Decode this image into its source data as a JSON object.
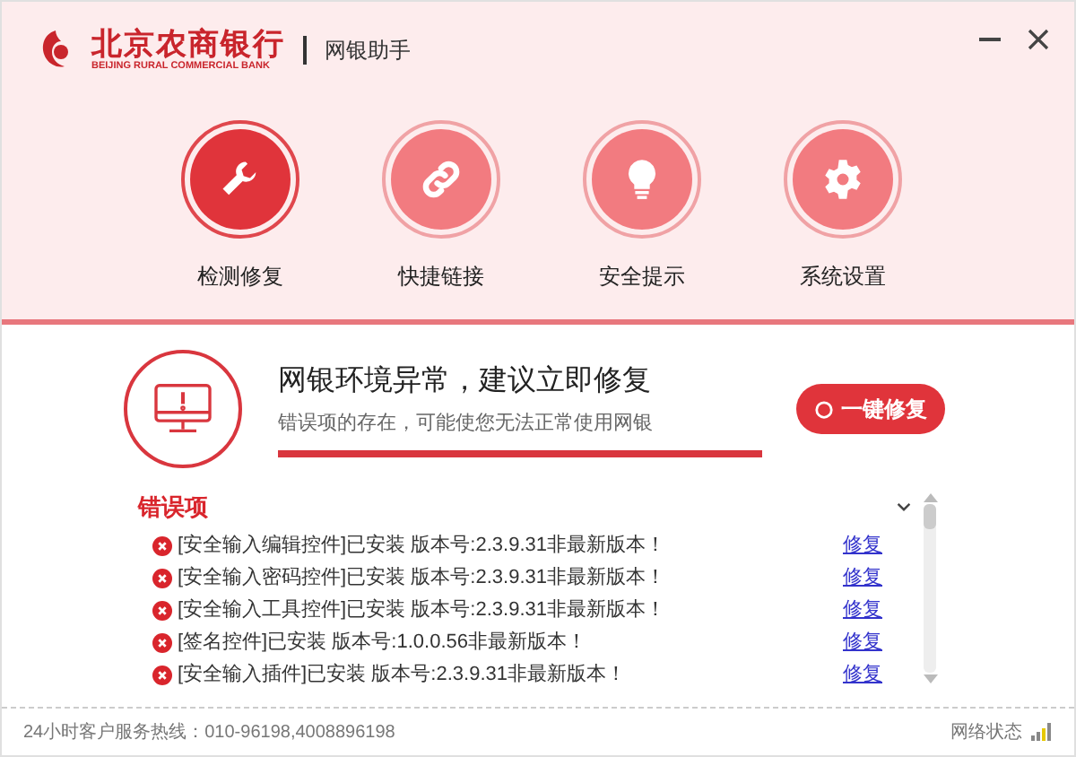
{
  "header": {
    "logo_name": "北京农商银行",
    "logo_subtitle": "BEIJING RURAL COMMERCIAL BANK",
    "app_name": "网银助手"
  },
  "nav": [
    {
      "label": "检测修复",
      "kind": "wrench",
      "selected": true
    },
    {
      "label": "快捷链接",
      "kind": "link",
      "selected": false
    },
    {
      "label": "安全提示",
      "kind": "bulb",
      "selected": false
    },
    {
      "label": "系统设置",
      "kind": "gear",
      "selected": false
    }
  ],
  "status": {
    "title": "网银环境异常，建议立即修复",
    "subtitle": "错误项的存在，可能使您无法正常使用网银",
    "level": 1,
    "fix_all_button": "一键修复"
  },
  "errors": {
    "heading": "错误项",
    "items": [
      {
        "text": "[安全输入编辑控件]已安装 版本号:2.3.9.31非最新版本！",
        "action": "修复"
      },
      {
        "text": "[安全输入密码控件]已安装 版本号:2.3.9.31非最新版本！",
        "action": "修复"
      },
      {
        "text": "[安全输入工具控件]已安装 版本号:2.3.9.31非最新版本！",
        "action": "修复"
      },
      {
        "text": "[签名控件]已安装 版本号:1.0.0.56非最新版本！",
        "action": "修复"
      },
      {
        "text": "[安全输入插件]已安装 版本号:2.3.9.31非最新版本！",
        "action": "修复"
      }
    ]
  },
  "status_bar": {
    "hotline": "24小时客户服务热线：010-96198,4008896198",
    "network": "网络状态"
  }
}
